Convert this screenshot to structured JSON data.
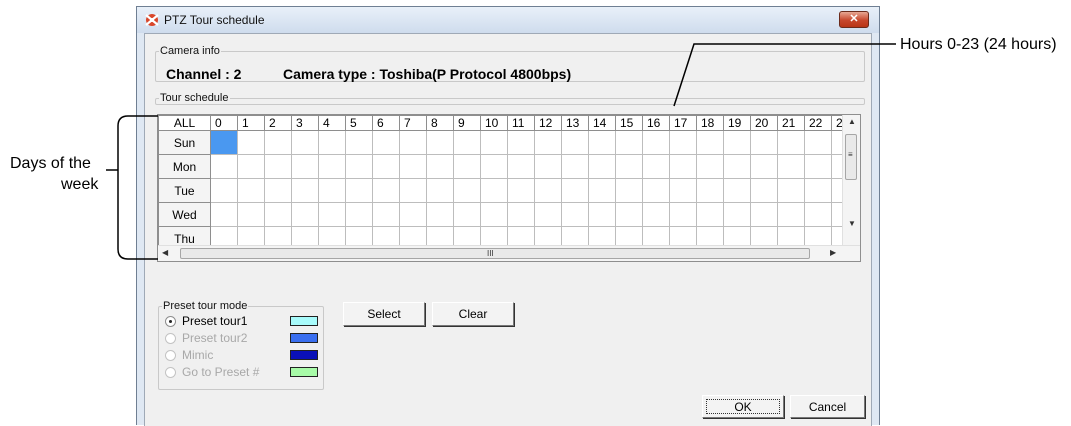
{
  "window": {
    "title": "PTZ Tour schedule",
    "close_label": "✕"
  },
  "camera_info": {
    "legend": "Camera info",
    "channel": "Channel : 2",
    "camera_type": "Camera type : Toshiba(P Protocol 4800bps)"
  },
  "tour_schedule": {
    "legend": "Tour schedule",
    "all_label": "ALL",
    "hours": [
      "0",
      "1",
      "2",
      "3",
      "4",
      "5",
      "6",
      "7",
      "8",
      "9",
      "10",
      "11",
      "12",
      "13",
      "14",
      "15",
      "16",
      "17",
      "18",
      "19",
      "20",
      "21",
      "22",
      "2"
    ],
    "days": [
      "Sun",
      "Mon",
      "Tue",
      "Wed",
      "Thu"
    ],
    "selected_cells": [
      {
        "day": "Sun",
        "hour": "0"
      }
    ],
    "scroll_markers": {
      "vertical": "≡",
      "horizontal": "III"
    }
  },
  "preset_tour_mode": {
    "legend": "Preset tour mode",
    "options": [
      {
        "label": "Preset tour1",
        "selected": true,
        "enabled": true,
        "color": "#a8fbfb"
      },
      {
        "label": "Preset tour2",
        "selected": false,
        "enabled": false,
        "color": "#3a6ff0"
      },
      {
        "label": "Mimic",
        "selected": false,
        "enabled": false,
        "color": "#0a10b8"
      },
      {
        "label": "Go to Preset #",
        "selected": false,
        "enabled": false,
        "color": "#a8fba8"
      }
    ]
  },
  "buttons": {
    "select": "Select",
    "clear": "Clear",
    "ok": "OK",
    "cancel": "Cancel"
  },
  "annotations": {
    "hours": "Hours 0-23 (24 hours)",
    "days_line1": "Days of the",
    "days_line2": "week"
  }
}
